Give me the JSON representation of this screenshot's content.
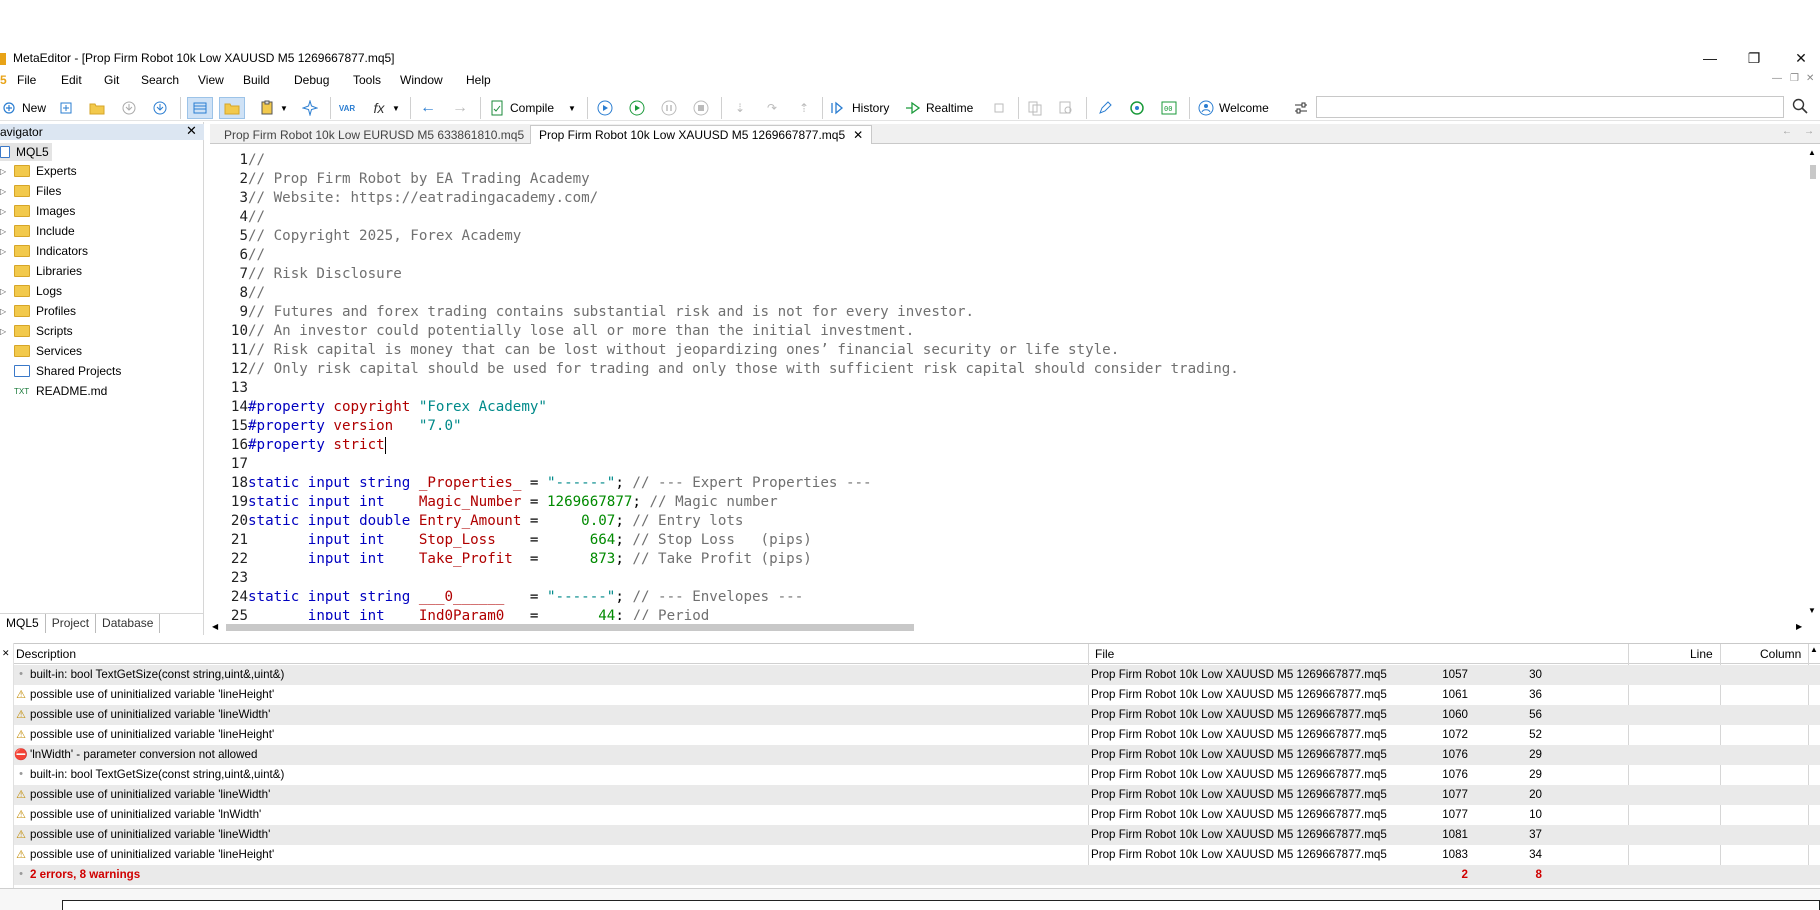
{
  "window": {
    "title": "MetaEditor - [Prop Firm Robot 10k Low XAUUSD M5 1269667877.mq5]",
    "min_glyph": "—",
    "max_glyph": "❐",
    "close_glyph": "✕"
  },
  "menu": {
    "logo": "5",
    "items": [
      "File",
      "Edit",
      "Git",
      "Search",
      "View",
      "Build",
      "Debug",
      "Tools",
      "Window",
      "Help"
    ],
    "mdi": [
      "—",
      "❐",
      "✕"
    ]
  },
  "toolbar": {
    "new_label": "New",
    "compile_label": "Compile",
    "history_label": "History",
    "realtime_label": "Realtime",
    "welcome_label": "Welcome",
    "var_label": "VAR",
    "fx_label": "fx",
    "search_placeholder": ""
  },
  "navigator": {
    "title": "avigator",
    "root": "MQL5",
    "items": [
      "Experts",
      "Files",
      "Images",
      "Include",
      "Indicators",
      "Libraries",
      "Logs",
      "Profiles",
      "Scripts",
      "Services",
      "Shared Projects",
      "README.md"
    ],
    "tabs": [
      "MQL5",
      "Project",
      "Database"
    ]
  },
  "editor": {
    "tabs": [
      {
        "label": "Prop Firm Robot 10k Low EURUSD M5 633861810.mq5"
      },
      {
        "label": "Prop Firm Robot 10k Low XAUUSD M5 1269667877.mq5"
      }
    ],
    "lines": [
      {
        "n": "1",
        "parts": [
          [
            "cm",
            "//"
          ]
        ]
      },
      {
        "n": "2",
        "parts": [
          [
            "cm",
            "// Prop Firm Robot by EA Trading Academy"
          ]
        ]
      },
      {
        "n": "3",
        "parts": [
          [
            "cm",
            "// Website: https://eatradingacademy.com/"
          ]
        ]
      },
      {
        "n": "4",
        "parts": [
          [
            "cm",
            "//"
          ]
        ]
      },
      {
        "n": "5",
        "parts": [
          [
            "cm",
            "// Copyright 2025, Forex Academy"
          ]
        ]
      },
      {
        "n": "6",
        "parts": [
          [
            "cm",
            "//"
          ]
        ]
      },
      {
        "n": "7",
        "parts": [
          [
            "cm",
            "// Risk Disclosure"
          ]
        ]
      },
      {
        "n": "8",
        "parts": [
          [
            "cm",
            "//"
          ]
        ]
      },
      {
        "n": "9",
        "parts": [
          [
            "cm",
            "// Futures and forex trading contains substantial risk and is not for every investor."
          ]
        ]
      },
      {
        "n": "10",
        "parts": [
          [
            "cm",
            "// An investor could potentially lose all or more than the initial investment."
          ]
        ]
      },
      {
        "n": "11",
        "parts": [
          [
            "cm",
            "// Risk capital is money that can be lost without jeopardizing ones’ financial security or life style."
          ]
        ]
      },
      {
        "n": "12",
        "parts": [
          [
            "cm",
            "// Only risk capital should be used for trading and only those with sufficient risk capital should consider trading."
          ]
        ]
      },
      {
        "n": "13",
        "parts": []
      },
      {
        "n": "14",
        "parts": [
          [
            "pp",
            "#property"
          ],
          [
            "op",
            " "
          ],
          [
            "pn",
            "copyright"
          ],
          [
            "op",
            " "
          ],
          [
            "st",
            "\"Forex Academy\""
          ]
        ]
      },
      {
        "n": "15",
        "parts": [
          [
            "pp",
            "#property"
          ],
          [
            "op",
            " "
          ],
          [
            "pn",
            "version"
          ],
          [
            "op",
            "   "
          ],
          [
            "st",
            "\"7.0\""
          ]
        ]
      },
      {
        "n": "16",
        "parts": [
          [
            "pp",
            "#property"
          ],
          [
            "op",
            " "
          ],
          [
            "pn",
            "strict"
          ]
        ],
        "caret": true
      },
      {
        "n": "17",
        "parts": []
      },
      {
        "n": "18",
        "parts": [
          [
            "kw",
            "static"
          ],
          [
            "op",
            " "
          ],
          [
            "kw",
            "input"
          ],
          [
            "op",
            " "
          ],
          [
            "ty",
            "string"
          ],
          [
            "op",
            " "
          ],
          [
            "vr",
            "_Properties_"
          ],
          [
            "op",
            " = "
          ],
          [
            "st",
            "\"------\""
          ],
          [
            "op",
            "; "
          ],
          [
            "cm",
            "// --- Expert Properties ---"
          ]
        ]
      },
      {
        "n": "19",
        "parts": [
          [
            "kw",
            "static"
          ],
          [
            "op",
            " "
          ],
          [
            "kw",
            "input"
          ],
          [
            "op",
            " "
          ],
          [
            "ty",
            "int"
          ],
          [
            "op",
            "    "
          ],
          [
            "vr",
            "Magic_Number"
          ],
          [
            "op",
            " = "
          ],
          [
            "nm",
            "1269667877"
          ],
          [
            "op",
            "; "
          ],
          [
            "cm",
            "// Magic number"
          ]
        ]
      },
      {
        "n": "20",
        "parts": [
          [
            "kw",
            "static"
          ],
          [
            "op",
            " "
          ],
          [
            "kw",
            "input"
          ],
          [
            "op",
            " "
          ],
          [
            "ty",
            "double"
          ],
          [
            "op",
            " "
          ],
          [
            "vr",
            "Entry_Amount"
          ],
          [
            "op",
            " =     "
          ],
          [
            "nm",
            "0.07"
          ],
          [
            "op",
            "; "
          ],
          [
            "cm",
            "// Entry lots"
          ]
        ]
      },
      {
        "n": "21",
        "parts": [
          [
            "op",
            "       "
          ],
          [
            "kw",
            "input"
          ],
          [
            "op",
            " "
          ],
          [
            "ty",
            "int"
          ],
          [
            "op",
            "    "
          ],
          [
            "vr",
            "Stop_Loss"
          ],
          [
            "op",
            "    =      "
          ],
          [
            "nm",
            "664"
          ],
          [
            "op",
            "; "
          ],
          [
            "cm",
            "// Stop Loss   (pips)"
          ]
        ]
      },
      {
        "n": "22",
        "parts": [
          [
            "op",
            "       "
          ],
          [
            "kw",
            "input"
          ],
          [
            "op",
            " "
          ],
          [
            "ty",
            "int"
          ],
          [
            "op",
            "    "
          ],
          [
            "vr",
            "Take_Profit"
          ],
          [
            "op",
            "  =      "
          ],
          [
            "nm",
            "873"
          ],
          [
            "op",
            "; "
          ],
          [
            "cm",
            "// Take Profit (pips)"
          ]
        ]
      },
      {
        "n": "23",
        "parts": []
      },
      {
        "n": "24",
        "parts": [
          [
            "kw",
            "static"
          ],
          [
            "op",
            " "
          ],
          [
            "kw",
            "input"
          ],
          [
            "op",
            " "
          ],
          [
            "ty",
            "string"
          ],
          [
            "op",
            " "
          ],
          [
            "vr",
            "___0______"
          ],
          [
            "op",
            "   = "
          ],
          [
            "st",
            "\"------\""
          ],
          [
            "op",
            "; "
          ],
          [
            "cm",
            "// --- Envelopes ---"
          ]
        ]
      },
      {
        "n": "25",
        "parts": [
          [
            "op",
            "       "
          ],
          [
            "kw",
            "input"
          ],
          [
            "op",
            " "
          ],
          [
            "ty",
            "int"
          ],
          [
            "op",
            "    "
          ],
          [
            "vr",
            "Ind0Param0"
          ],
          [
            "op",
            "   =       "
          ],
          [
            "nm",
            "44"
          ],
          [
            "op",
            "; "
          ],
          [
            "cm",
            "// Period"
          ]
        ]
      }
    ]
  },
  "errors": {
    "headers": {
      "description": "Description",
      "file": "File",
      "line": "Line",
      "column": "Column"
    },
    "rows": [
      {
        "type": "info",
        "description": "   built-in: bool TextGetSize(const string,uint&,uint&)",
        "file": "Prop Firm Robot 10k Low XAUUSD M5 1269667877.mq5",
        "line": "1057",
        "column": "30"
      },
      {
        "type": "warning",
        "description": "possible use of uninitialized variable 'lineHeight'",
        "file": "Prop Firm Robot 10k Low XAUUSD M5 1269667877.mq5",
        "line": "1061",
        "column": "36"
      },
      {
        "type": "warning",
        "description": "possible use of uninitialized variable 'lineWidth'",
        "file": "Prop Firm Robot 10k Low XAUUSD M5 1269667877.mq5",
        "line": "1060",
        "column": "56"
      },
      {
        "type": "warning",
        "description": "possible use of uninitialized variable 'lineHeight'",
        "file": "Prop Firm Robot 10k Low XAUUSD M5 1269667877.mq5",
        "line": "1072",
        "column": "52"
      },
      {
        "type": "error",
        "description": "'lnWidth' - parameter conversion not allowed",
        "file": "Prop Firm Robot 10k Low XAUUSD M5 1269667877.mq5",
        "line": "1076",
        "column": "29"
      },
      {
        "type": "info",
        "description": "   built-in: bool TextGetSize(const string,uint&,uint&)",
        "file": "Prop Firm Robot 10k Low XAUUSD M5 1269667877.mq5",
        "line": "1076",
        "column": "29"
      },
      {
        "type": "warning",
        "description": "possible use of uninitialized variable 'lineWidth'",
        "file": "Prop Firm Robot 10k Low XAUUSD M5 1269667877.mq5",
        "line": "1077",
        "column": "20"
      },
      {
        "type": "warning",
        "description": "possible use of uninitialized variable 'lnWidth'",
        "file": "Prop Firm Robot 10k Low XAUUSD M5 1269667877.mq5",
        "line": "1077",
        "column": "10"
      },
      {
        "type": "warning",
        "description": "possible use of uninitialized variable 'lineWidth'",
        "file": "Prop Firm Robot 10k Low XAUUSD M5 1269667877.mq5",
        "line": "1081",
        "column": "37"
      },
      {
        "type": "warning",
        "description": "possible use of uninitialized variable 'lineHeight'",
        "file": "Prop Firm Robot 10k Low XAUUSD M5 1269667877.mq5",
        "line": "1083",
        "column": "34"
      },
      {
        "type": "summary",
        "description": "2 errors, 8 warnings",
        "file": "",
        "line": "2",
        "column": "8"
      }
    ]
  },
  "colors": {
    "accent": "#e8a317",
    "warning": "#c08a00",
    "error": "#d00000",
    "nav_header": "#dce6f2"
  }
}
